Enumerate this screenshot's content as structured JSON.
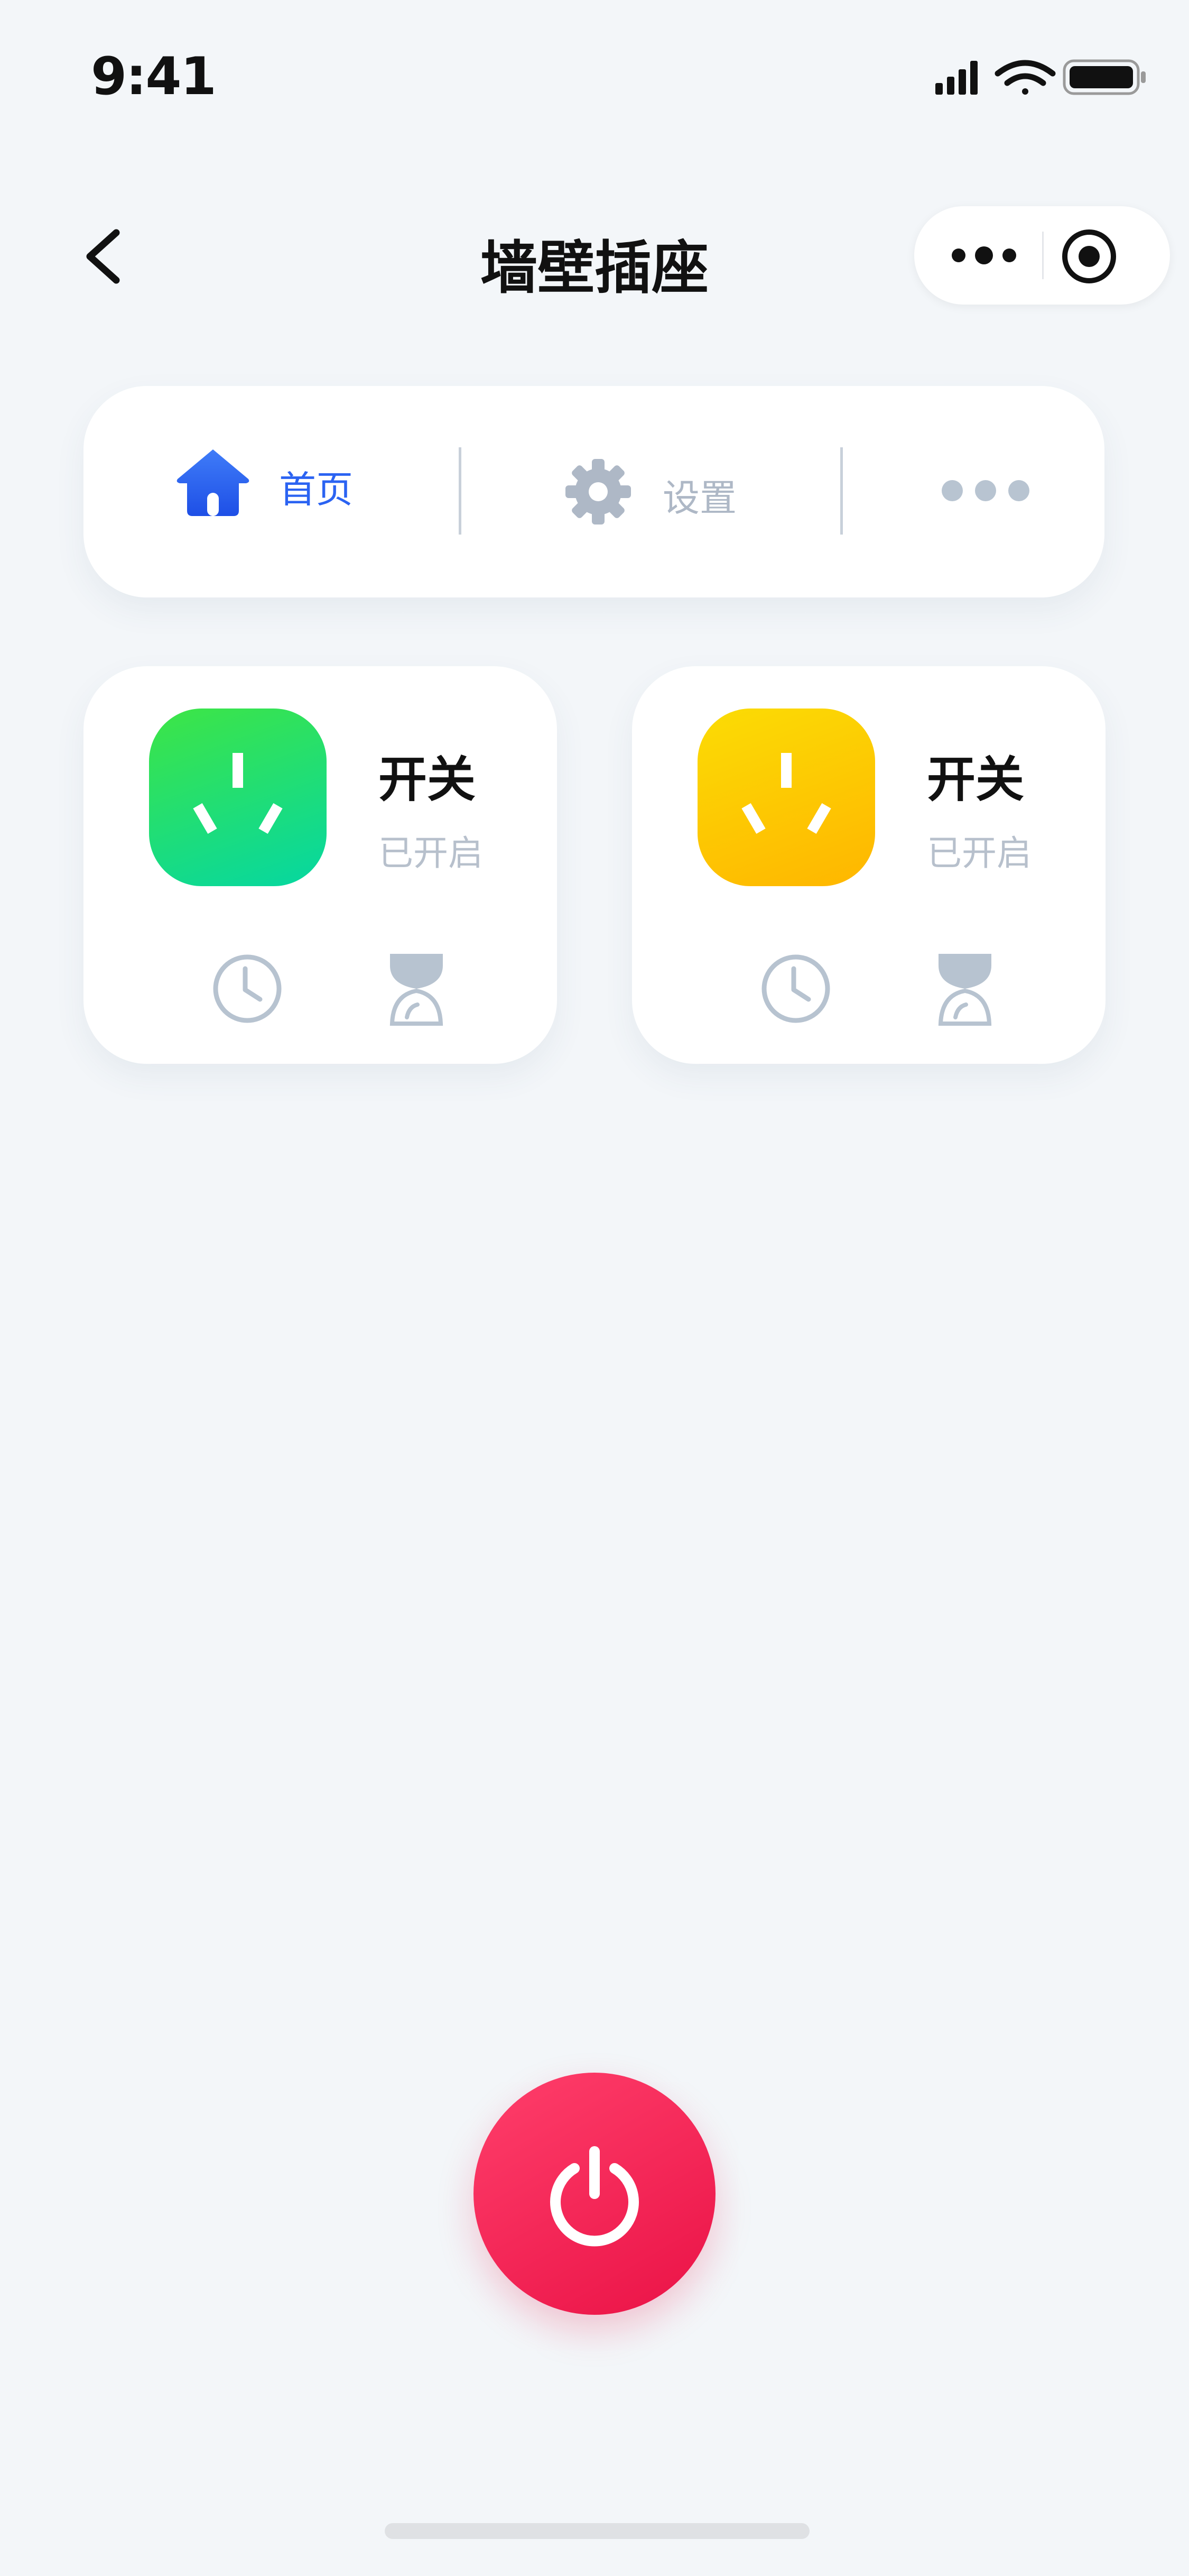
{
  "status_bar": {
    "time": "9:41"
  },
  "nav": {
    "title": "墙壁插座"
  },
  "tabs": [
    {
      "label": "首页",
      "icon": "home-icon",
      "active": true
    },
    {
      "label": "设置",
      "icon": "gear-icon",
      "active": false
    },
    {
      "label": "",
      "icon": "more-dots-icon",
      "active": false
    }
  ],
  "sockets": [
    {
      "title": "开关",
      "status": "已开启",
      "color": "#10dd7a"
    },
    {
      "title": "开关",
      "status": "已开启",
      "color": "#ffc800"
    }
  ],
  "colors": {
    "accent": "#2b63f2",
    "power": "#f0234f",
    "inactive": "#aeb8c6",
    "background": "#f3f6f9"
  }
}
